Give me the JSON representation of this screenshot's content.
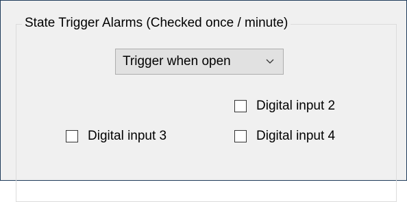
{
  "group": {
    "title": "State Trigger Alarms (Checked once / minute)"
  },
  "trigger_select": {
    "selected": "Trigger when open",
    "icon": "chevron-down-icon"
  },
  "checkboxes": [
    {
      "label": "Digital input 2",
      "checked": false
    },
    {
      "label": "Digital input 3",
      "checked": false
    },
    {
      "label": "Digital input 4",
      "checked": false
    }
  ],
  "colors": {
    "window_border": "#1f3b5a",
    "background": "#f0f0f0",
    "combo_background": "#e1e1e1"
  }
}
